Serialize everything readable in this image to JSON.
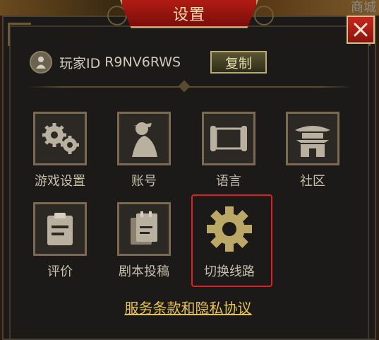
{
  "window": {
    "title": "设置",
    "shop_label": "商城"
  },
  "player": {
    "label": "玩家ID",
    "id": "R9NV6RWS",
    "copy_label": "复制"
  },
  "grid": {
    "row1": [
      {
        "label": "游戏设置",
        "icon": "gears-icon"
      },
      {
        "label": "账号",
        "icon": "account-icon"
      },
      {
        "label": "语言",
        "icon": "scroll-icon"
      },
      {
        "label": "社区",
        "icon": "pagoda-icon"
      }
    ],
    "row2": [
      {
        "label": "评价",
        "icon": "clipboard-icon"
      },
      {
        "label": "剧本投稿",
        "icon": "documents-icon"
      },
      {
        "label": "切换线路",
        "icon": "gear-icon"
      }
    ]
  },
  "footer": {
    "terms_label": "服务条款和隐私协议"
  },
  "colors": {
    "accent": "#e6c35a",
    "banner": "#b11c14",
    "highlight": "#e02020"
  }
}
